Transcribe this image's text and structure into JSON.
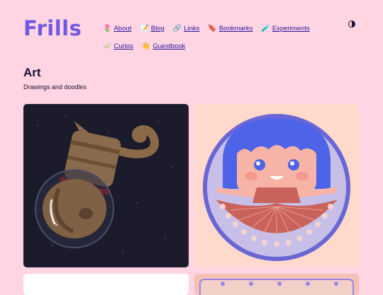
{
  "site": {
    "logo": "Frills"
  },
  "nav": {
    "row1": [
      {
        "icon": "tulip-icon",
        "glyph": "🌷",
        "label": "About"
      },
      {
        "icon": "memo-icon",
        "glyph": "📝",
        "label": "Blog"
      },
      {
        "icon": "link-icon",
        "glyph": "🔗",
        "label": "Links"
      },
      {
        "icon": "bookmark-icon",
        "glyph": "🔖",
        "label": "Bookmarks"
      },
      {
        "icon": "test-tube-icon",
        "glyph": "🧪",
        "label": "Experiments"
      }
    ],
    "row2": [
      {
        "icon": "ringed-planet-icon",
        "glyph": "🪐",
        "label": "Curios"
      },
      {
        "icon": "wave-icon",
        "glyph": "👋",
        "label": "Guestbook"
      }
    ]
  },
  "page": {
    "title": "Art",
    "subtitle": "Drawings and doodles"
  },
  "colors": {
    "background": "#ffd4e3",
    "accent": "#6f59e3",
    "link": "#2a1a9e"
  }
}
